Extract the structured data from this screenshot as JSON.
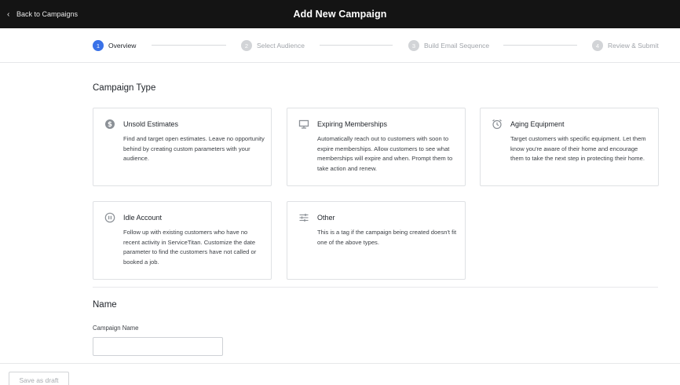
{
  "header": {
    "back_label": "Back to Campaigns",
    "title": "Add New Campaign"
  },
  "stepper": {
    "steps": [
      {
        "number": "1",
        "label": "Overview",
        "state": "active"
      },
      {
        "number": "2",
        "label": "Select Audience",
        "state": "inactive"
      },
      {
        "number": "3",
        "label": "Build Email Sequence",
        "state": "inactive"
      },
      {
        "number": "4",
        "label": "Review & Submit",
        "state": "inactive"
      }
    ]
  },
  "campaign_type": {
    "heading": "Campaign Type",
    "cards": [
      {
        "icon": "dollar-circle-icon",
        "title": "Unsold Estimates",
        "description": "Find and target open estimates. Leave no opportunity behind by creating custom parameters with your audience."
      },
      {
        "icon": "monitor-icon",
        "title": "Expiring Memberships",
        "description": "Automatically reach out to customers with soon to expire memberships. Allow customers to see what memberships will expire and when. Prompt them to take action and renew."
      },
      {
        "icon": "alarm-clock-icon",
        "title": "Aging Equipment",
        "description": "Target customers with specific equipment. Let them know you're aware of their home and encourage them to take the next step in protecting their home."
      },
      {
        "icon": "pause-circle-icon",
        "title": "Idle Account",
        "description": "Follow up with existing customers who have no recent activity in ServiceTitan. Customize the date parameter to find the customers have not called or booked a job."
      },
      {
        "icon": "sliders-icon",
        "title": "Other",
        "description": "This is a tag if the campaign being created doesn't fit one of the above types."
      }
    ]
  },
  "name_section": {
    "heading": "Name",
    "field_label": "Campaign Name",
    "field_value": "",
    "field_placeholder": ""
  },
  "footer": {
    "save_draft_label": "Save as draft"
  },
  "colors": {
    "header_bg": "#141414",
    "accent": "#3a72e8",
    "inactive_step": "#d2d4d7"
  }
}
